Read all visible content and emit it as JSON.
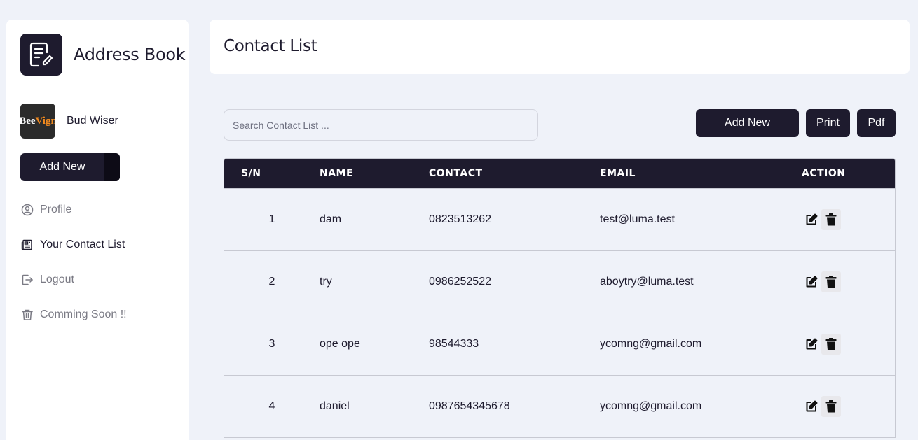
{
  "app": {
    "title": "Address Book",
    "user_name": "Bud Wiser",
    "avatar_text_1": "Bee",
    "avatar_text_2": "Vign",
    "sidebar_add_label": "Add New"
  },
  "nav": [
    {
      "label": "Profile",
      "icon": "user-circle-icon",
      "active": false
    },
    {
      "label": "Your Contact List",
      "icon": "newspaper-icon",
      "active": true
    },
    {
      "label": "Logout",
      "icon": "logout-icon",
      "active": false
    },
    {
      "label": "Comming Soon !!",
      "icon": "trash-icon",
      "active": false
    }
  ],
  "header": {
    "title": "Contact List"
  },
  "toolbar": {
    "search_placeholder": "Search Contact List ...",
    "add_label": "Add New",
    "print_label": "Print",
    "pdf_label": "Pdf"
  },
  "table": {
    "columns": [
      "S/N",
      "NAME",
      "CONTACT",
      "EMAIL",
      "ACTION"
    ],
    "rows": [
      {
        "sn": "1",
        "name": "dam",
        "contact": "0823513262",
        "email": "test@luma.test"
      },
      {
        "sn": "2",
        "name": "try",
        "contact": "0986252522",
        "email": "aboytry@luma.test"
      },
      {
        "sn": "3",
        "name": "ope ope",
        "contact": "98544333",
        "email": "ycomng@gmail.com"
      },
      {
        "sn": "4",
        "name": "daniel",
        "contact": "0987654345678",
        "email": "ycomng@gmail.com"
      }
    ]
  },
  "colors": {
    "primary": "#1e1b2e",
    "background": "#eff2f9",
    "card": "#ffffff",
    "muted_text": "#7a7a84"
  }
}
